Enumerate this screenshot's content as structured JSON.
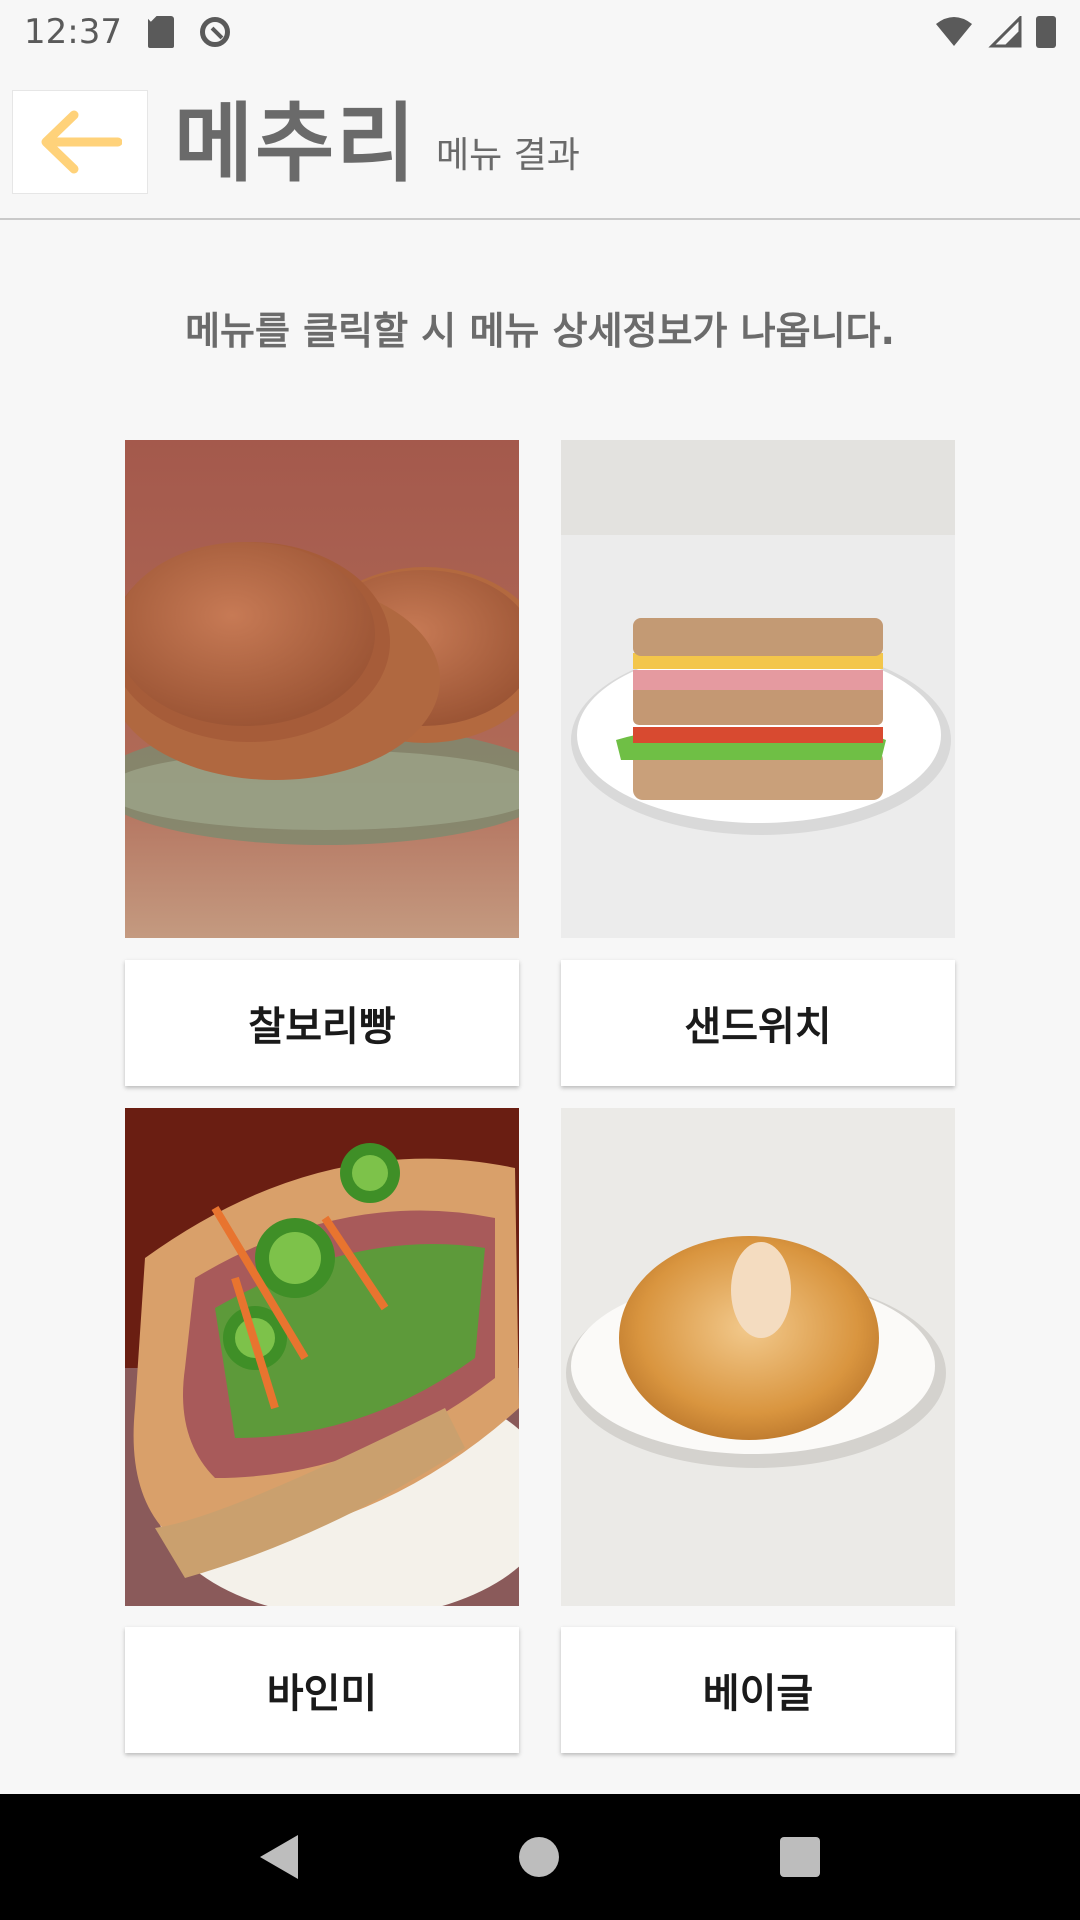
{
  "status_bar": {
    "time": "12:37",
    "icons": [
      "sd-card-icon",
      "do-not-disturb-icon",
      "wifi-icon",
      "signal-icon",
      "battery-icon"
    ]
  },
  "header": {
    "back_icon": "arrow-left-icon",
    "title": "메추리",
    "subtitle": "메뉴 결과"
  },
  "instruction": "메뉴를 클릭할 시 메뉴 상세정보가 나옵니다.",
  "menu": [
    {
      "name": "찰보리빵",
      "image": "pancake-photo"
    },
    {
      "name": "샌드위치",
      "image": "sandwich-photo"
    },
    {
      "name": "바인미",
      "image": "banh-mi-photo"
    },
    {
      "name": "베이글",
      "image": "bagel-photo"
    }
  ],
  "nav_bar": {
    "buttons": [
      "back-triangle-icon",
      "home-circle-icon",
      "recent-square-icon"
    ]
  },
  "colors": {
    "accent": "#FFD27A",
    "title_gray": "#6A6A6A",
    "background": "#F7F7F7"
  }
}
